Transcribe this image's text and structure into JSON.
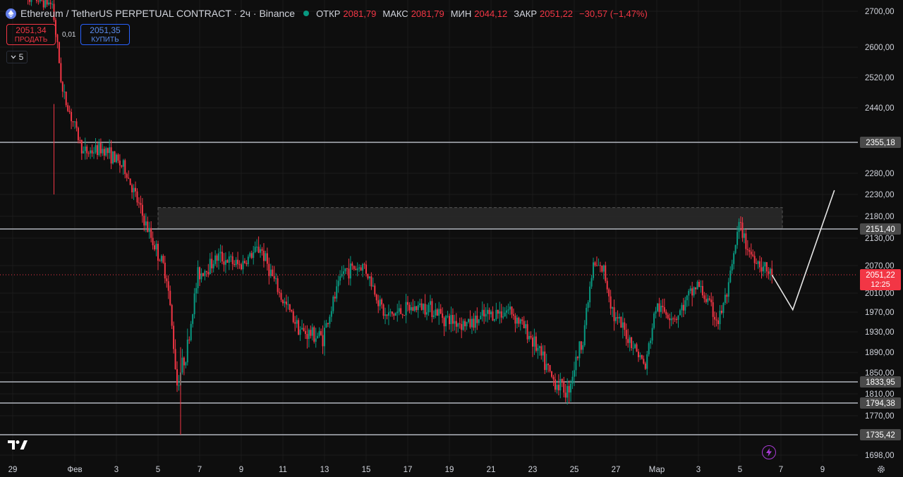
{
  "header": {
    "symbol_title": "Ethereum / TetherUS PERPETUAL CONTRACT · 2ч · Binance",
    "ohlc": [
      {
        "label": "ОТКР",
        "value": "2081,79"
      },
      {
        "label": "МАКС",
        "value": "2081,79"
      },
      {
        "label": "МИН",
        "value": "2044,12"
      },
      {
        "label": "ЗАКР",
        "value": "2051,22"
      }
    ],
    "change": "−30,57 (−1,47%)"
  },
  "trade": {
    "sell_price": "2051,34",
    "sell_label": "ПРОДАТЬ",
    "buy_price": "2051,35",
    "buy_label": "КУПИТЬ",
    "spread": "0,01"
  },
  "indicator_button": "5",
  "price_scale": {
    "ticks": [
      {
        "value": 2700,
        "label": "2700,00"
      },
      {
        "value": 2600,
        "label": "2600,00"
      },
      {
        "value": 2520,
        "label": "2520,00"
      },
      {
        "value": 2440,
        "label": "2440,00"
      },
      {
        "value": 2280,
        "label": "2280,00"
      },
      {
        "value": 2230,
        "label": "2230,00"
      },
      {
        "value": 2180,
        "label": "2180,00"
      },
      {
        "value": 2130,
        "label": "2130,00"
      },
      {
        "value": 2070,
        "label": "2070,00"
      },
      {
        "value": 2010,
        "label": "2010,00"
      },
      {
        "value": 1970,
        "label": "1970,00"
      },
      {
        "value": 1930,
        "label": "1930,00"
      },
      {
        "value": 1890,
        "label": "1890,00"
      },
      {
        "value": 1850,
        "label": "1850,00"
      },
      {
        "value": 1810,
        "label": "1810,00"
      },
      {
        "value": 1770,
        "label": "1770,00"
      },
      {
        "value": 1698,
        "label": "1698,00"
      }
    ],
    "levels": [
      {
        "value": 2355.18,
        "label": "2355,18"
      },
      {
        "value": 2151.4,
        "label": "2151,40"
      },
      {
        "value": 1833.95,
        "label": "1833,95"
      },
      {
        "value": 1794.38,
        "label": "1794,38"
      },
      {
        "value": 1735.42,
        "label": "1735,42"
      }
    ],
    "current_price": {
      "value": 2051.22,
      "label": "2051,22",
      "countdown": "12:25"
    }
  },
  "time_scale": {
    "labels": [
      "29",
      "Фев",
      "3",
      "5",
      "7",
      "9",
      "11",
      "13",
      "15",
      "17",
      "19",
      "21",
      "23",
      "25",
      "27",
      "Мар",
      "3",
      "5",
      "7",
      "9"
    ]
  },
  "colors": {
    "up": "#089981",
    "down": "#f23645",
    "background": "#0e0e0e",
    "level_line": "#b2b5be",
    "zone": "#2a2a2a"
  },
  "icons": {
    "logo": "tradingview-logo-icon",
    "bolt": "lightning-icon",
    "settings": "gear-icon",
    "coin": "ethereum-icon"
  },
  "chart_data": {
    "type": "candlestick",
    "interval": "2ч",
    "symbol": "ETHUSDT.P",
    "ylim": [
      1698,
      2725
    ],
    "grid": true,
    "anchors": [
      {
        "x": "29 Jan",
        "price": 2760
      },
      {
        "x": "31 Jan 00:00",
        "price": 2720
      },
      {
        "x": "31 Jan 12:00",
        "price": 2480
      },
      {
        "x": "1 Feb 12:00",
        "price": 2330
      },
      {
        "x": "2 Feb 12:00",
        "price": 2340
      },
      {
        "x": "3 Feb 12:00",
        "price": 2290
      },
      {
        "x": "4 Feb 12:00",
        "price": 2160
      },
      {
        "x": "5 Feb 12:00",
        "price": 2050
      },
      {
        "x": "6 Feb 00:00",
        "price": 1830
      },
      {
        "x": "6 Feb 12:00",
        "price": 1900
      },
      {
        "x": "7 Feb 00:00",
        "price": 2050
      },
      {
        "x": "8 Feb 00:00",
        "price": 2090
      },
      {
        "x": "9 Feb 00:00",
        "price": 2070
      },
      {
        "x": "10 Feb 00:00",
        "price": 2110
      },
      {
        "x": "11 Feb 00:00",
        "price": 2000
      },
      {
        "x": "12 Feb 00:00",
        "price": 1930
      },
      {
        "x": "13 Feb 00:00",
        "price": 1920
      },
      {
        "x": "14 Feb 00:00",
        "price": 2060
      },
      {
        "x": "15 Feb 00:00",
        "price": 2070
      },
      {
        "x": "16 Feb 00:00",
        "price": 1960
      },
      {
        "x": "17 Feb 00:00",
        "price": 1975
      },
      {
        "x": "18 Feb 00:00",
        "price": 1985
      },
      {
        "x": "19 Feb 00:00",
        "price": 1955
      },
      {
        "x": "20 Feb 00:00",
        "price": 1945
      },
      {
        "x": "21 Feb 00:00",
        "price": 1965
      },
      {
        "x": "22 Feb 00:00",
        "price": 1975
      },
      {
        "x": "23 Feb 00:00",
        "price": 1920
      },
      {
        "x": "24 Feb 00:00",
        "price": 1840
      },
      {
        "x": "24 Feb 18:00",
        "price": 1815
      },
      {
        "x": "25 Feb 12:00",
        "price": 1920
      },
      {
        "x": "26 Feb 00:00",
        "price": 2070
      },
      {
        "x": "26 Feb 12:00",
        "price": 2060
      },
      {
        "x": "27 Feb 00:00",
        "price": 1960
      },
      {
        "x": "28 Feb 00:00",
        "price": 1900
      },
      {
        "x": "28 Feb 12:00",
        "price": 1860
      },
      {
        "x": "1 Mar 00:00",
        "price": 1980
      },
      {
        "x": "2 Mar 00:00",
        "price": 1960
      },
      {
        "x": "3 Mar 00:00",
        "price": 2030
      },
      {
        "x": "4 Mar 00:00",
        "price": 1950
      },
      {
        "x": "4 Mar 12:00",
        "price": 2020
      },
      {
        "x": "5 Mar 00:00",
        "price": 2160
      },
      {
        "x": "5 Mar 12:00",
        "price": 2100
      },
      {
        "x": "6 Mar 12:00",
        "price": 2051
      }
    ],
    "drawings": {
      "horizontal_levels": [
        2355.18,
        2151.4,
        1833.95,
        1794.38,
        1735.42
      ],
      "resistance_zone": {
        "from": 2151.4,
        "to": 2200,
        "start": "5 Feb",
        "end": "7 Mar"
      },
      "projection_path": [
        {
          "x": "6 Mar 12:00",
          "price": 2051
        },
        {
          "x": "7 Mar 12:00",
          "price": 1975
        },
        {
          "x": "9 Mar 12:00",
          "price": 2240
        }
      ]
    }
  }
}
